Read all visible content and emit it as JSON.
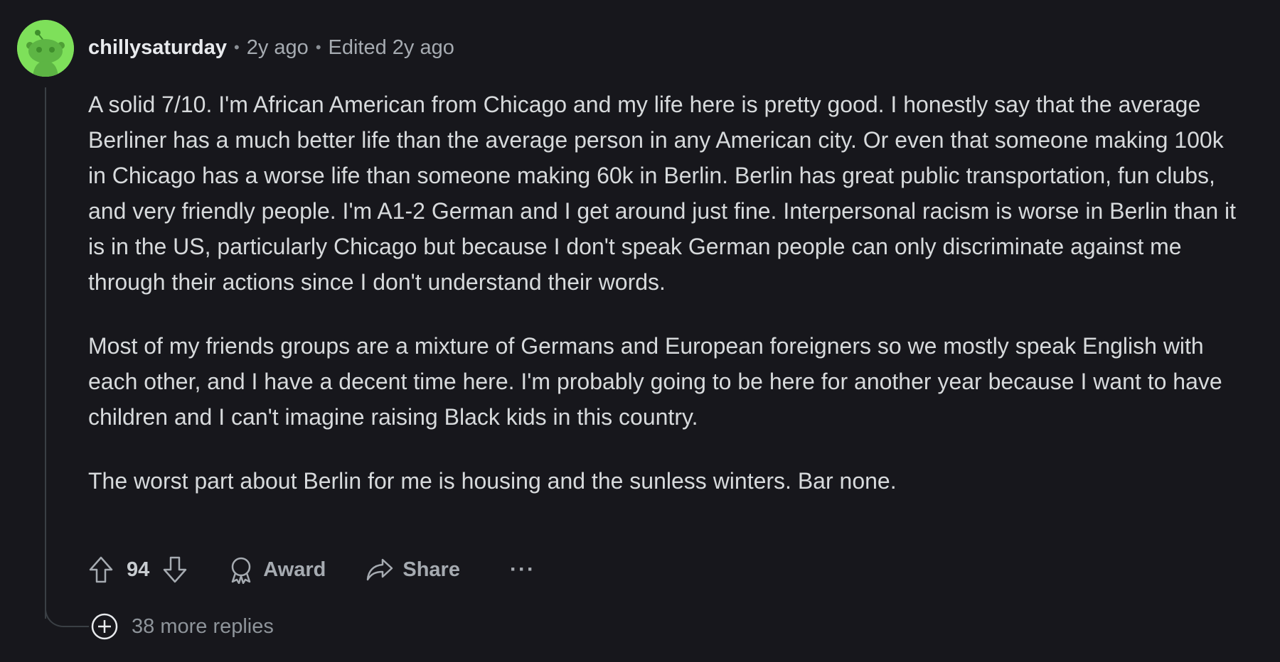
{
  "comment": {
    "username": "chillysaturday",
    "age": "2y ago",
    "edited": "Edited 2y ago",
    "paragraphs": [
      "A solid 7/10. I'm African American from Chicago and my life here is pretty good. I honestly say that the average Berliner has a much better life than the average person in any American city. Or even that someone making 100k in Chicago has a worse life than someone making 60k in Berlin. Berlin has great public transportation, fun clubs, and very friendly people. I'm A1-2 German and I get around just fine. Interpersonal racism is worse in Berlin than it is in the US, particularly Chicago but because I don't speak German people can only discriminate against me through their actions since I don't understand their words.",
      "Most of my friends groups are a mixture of Germans and European foreigners so we mostly speak English with each other, and I have a decent time here. I'm probably going to be here for another year because I want to have children and I can't imagine raising Black kids in this country.",
      "The worst part about Berlin for me is housing and the sunless winters. Bar none."
    ],
    "score": "94",
    "award_label": "Award",
    "share_label": "Share",
    "more_label": "···",
    "more_replies": "38 more replies"
  },
  "icons": {
    "avatar": "snoo-avatar",
    "upvote": "upvote-arrow-icon",
    "downvote": "downvote-arrow-icon",
    "award": "award-icon",
    "share": "share-icon",
    "expand": "plus-circle-icon"
  },
  "colors": {
    "background": "#17171c",
    "avatar_bg": "#7ee05a",
    "text": "#d7dadc",
    "muted": "#a6abb1"
  }
}
